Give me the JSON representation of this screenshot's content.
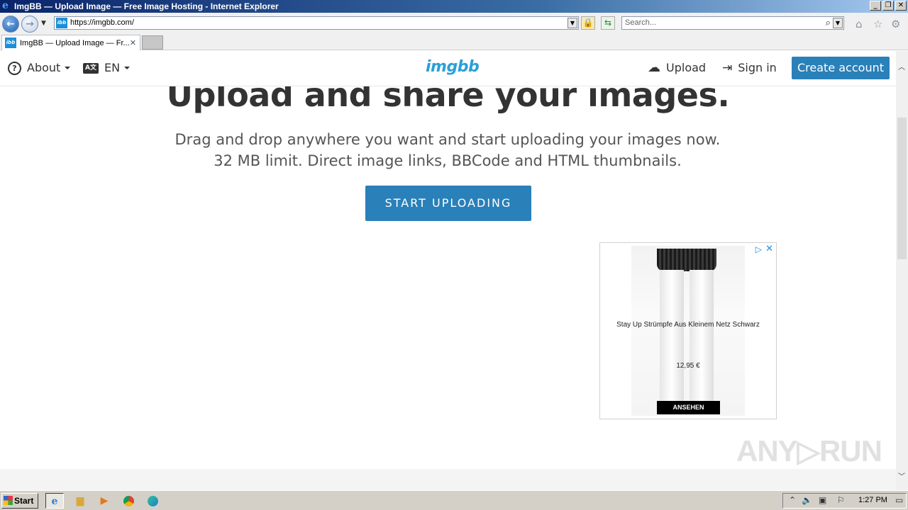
{
  "window": {
    "title": "ImgBB — Upload Image — Free Image Hosting - Internet Explorer",
    "minimize": "_",
    "restore": "❐",
    "close": "✕"
  },
  "addressbar": {
    "url": "https://imgbb.com/",
    "search_placeholder": "Search...",
    "favicon_text": "ibb"
  },
  "tabs": [
    {
      "title": "ImgBB — Upload Image — Fr...",
      "close": "✕"
    }
  ],
  "site": {
    "nav": {
      "about": "About",
      "language": "EN",
      "language_icon": "A文",
      "logo": "imgbb",
      "upload": "Upload",
      "signin": "Sign in",
      "create_account": "Create account"
    },
    "hero": {
      "title": "Upload and share your images.",
      "subtitle": "Drag and drop anywhere you want and start uploading your images now. 32 MB limit. Direct image links, BBCode and HTML thumbnails.",
      "cta": "START UPLOADING"
    },
    "ad": {
      "product": "Stay Up Strümpfe Aus Kleinem Netz Schwarz",
      "price": "12,95 €",
      "cta": "ANSEHEN"
    }
  },
  "watermark": "ANY▷RUN",
  "taskbar": {
    "start": "Start",
    "clock": "1:27 PM",
    "apps": [
      "internet-explorer",
      "file-explorer",
      "media-player",
      "chrome",
      "edge"
    ]
  },
  "colors": {
    "accent": "#2a80b9",
    "logo": "#2a9fd8",
    "text": "#333333"
  }
}
